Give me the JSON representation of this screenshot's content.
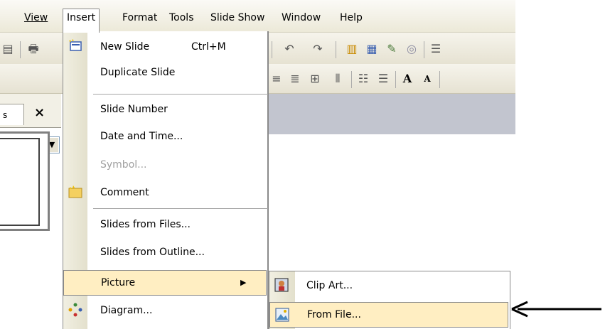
{
  "menubar": {
    "items": [
      {
        "label": "View",
        "mnemonic_index": 0
      },
      {
        "label": "Insert",
        "mnemonic_index": 0
      },
      {
        "label": "Format",
        "mnemonic_index": 1
      },
      {
        "label": "Tools",
        "mnemonic_index": 0
      },
      {
        "label": "Slide Show",
        "mnemonic_index": 3
      },
      {
        "label": "Window",
        "mnemonic_index": 0
      },
      {
        "label": "Help",
        "mnemonic_index": 0
      }
    ]
  },
  "tabs": {
    "close_glyph": "×",
    "tab_label": "s"
  },
  "insert_menu": {
    "items": [
      {
        "label": "New Slide",
        "shortcut": "Ctrl+M",
        "icon": "new-slide-icon"
      },
      {
        "label": "Duplicate Slide"
      },
      {
        "label": "Slide Number"
      },
      {
        "label": "Date and Time..."
      },
      {
        "label": "Symbol..."
      },
      {
        "label": "Comment",
        "icon": "comment-icon"
      },
      {
        "label": "Slides from Files..."
      },
      {
        "label": "Slides from Outline..."
      },
      {
        "label": "Picture"
      },
      {
        "label": "Diagram...",
        "icon": "diagram-icon"
      }
    ]
  },
  "picture_submenu": {
    "items": [
      {
        "label": "Clip Art...",
        "icon": "clip-art-icon"
      },
      {
        "label": "From File...",
        "icon": "from-file-icon"
      }
    ]
  },
  "colors": {
    "menu_highlight": "#ffeec2",
    "gutter": "#e3e0cc",
    "workspace_bar": "#c2c5cf"
  }
}
